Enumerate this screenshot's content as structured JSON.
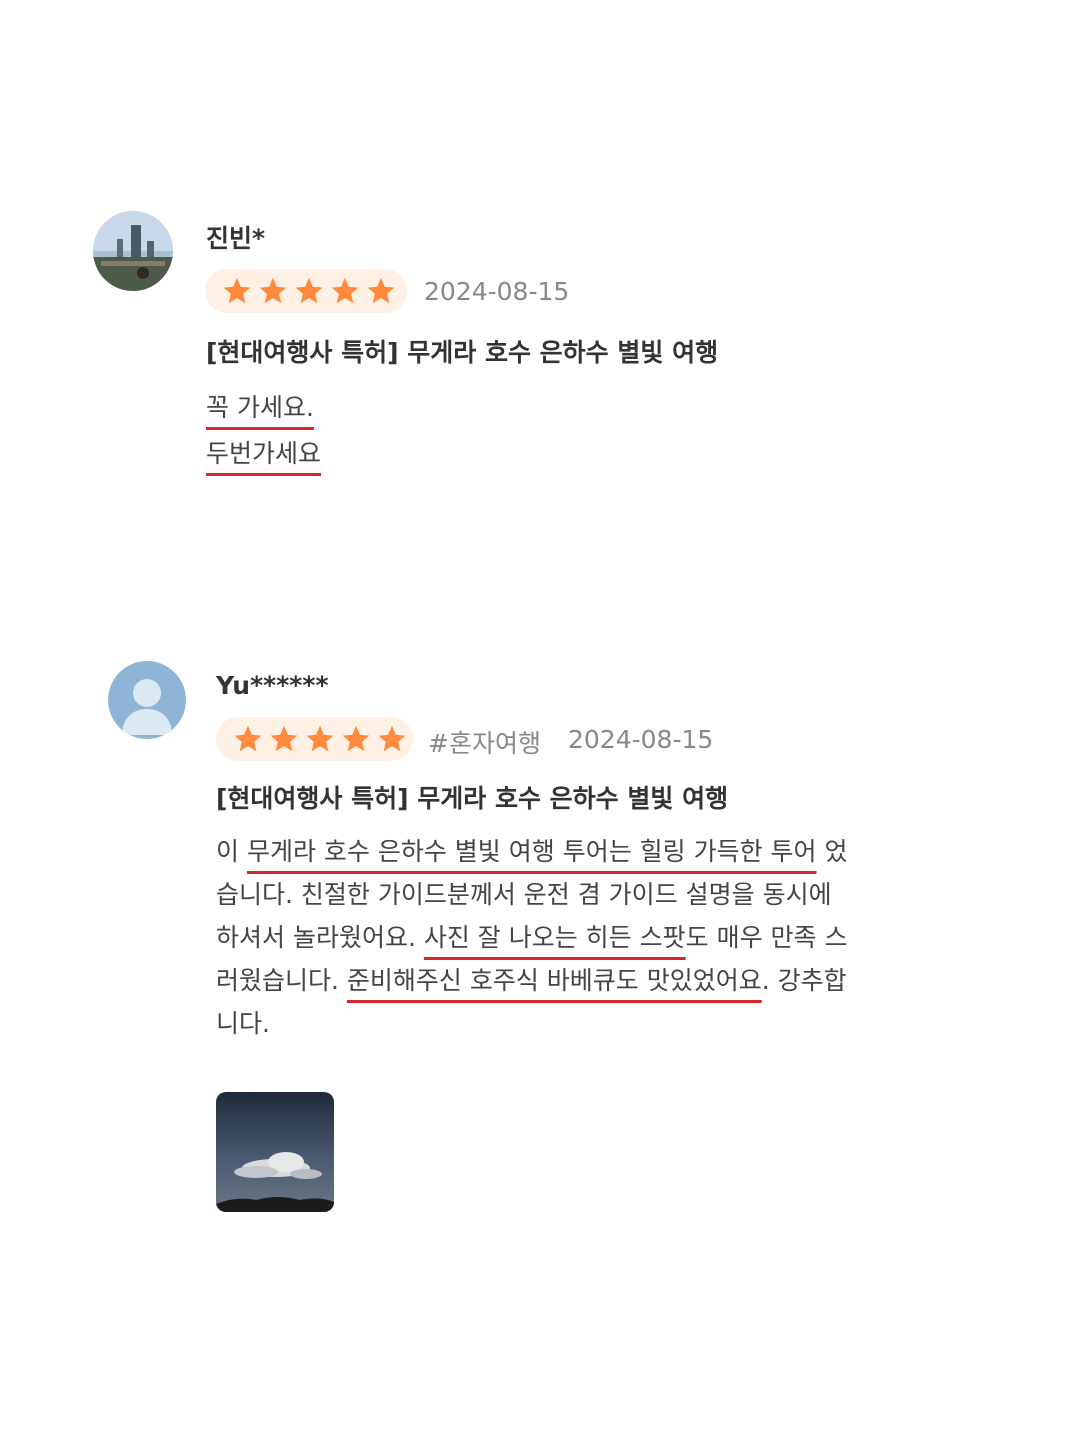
{
  "reviews": [
    {
      "user": "진빈*",
      "rating": 5,
      "date": "2024-08-15",
      "product": "[현대여행사 특허] 무게라 호수 은하수 별빛 여행",
      "lines": [
        "꼭 가세요.",
        "두번가세요"
      ]
    },
    {
      "user": "Yu******",
      "rating": 5,
      "tag": "#혼자여행",
      "date": "2024-08-15",
      "product": "[현대여행사 특허] 무게라 호수 은하수 별빛 여행",
      "line1": {
        "a": "이 ",
        "u": "무게라 호수 은하수 별빛 여행 투어는 힐링 가득한 투어",
        "b": " 었"
      },
      "line2": "습니다. 친절한 가이드분께서 운전 겸 가이드 설명을 동시에",
      "line3": {
        "a": "하셔서 놀라웠어요. ",
        "u": "사진 잘 나오는 히든 스팟",
        "b": "도 매우 만족 스"
      },
      "line4": {
        "a": "러웠습니다. ",
        "u": "준비해주신 호주식 바베큐도 맛있었어요",
        "b": ". 강추합"
      },
      "line5": "니다."
    }
  ],
  "colors": {
    "star": "#ff8a3d",
    "pill": "#fff0e6",
    "underline": "#d9262c",
    "avatar_default": "#8fb5d6"
  }
}
